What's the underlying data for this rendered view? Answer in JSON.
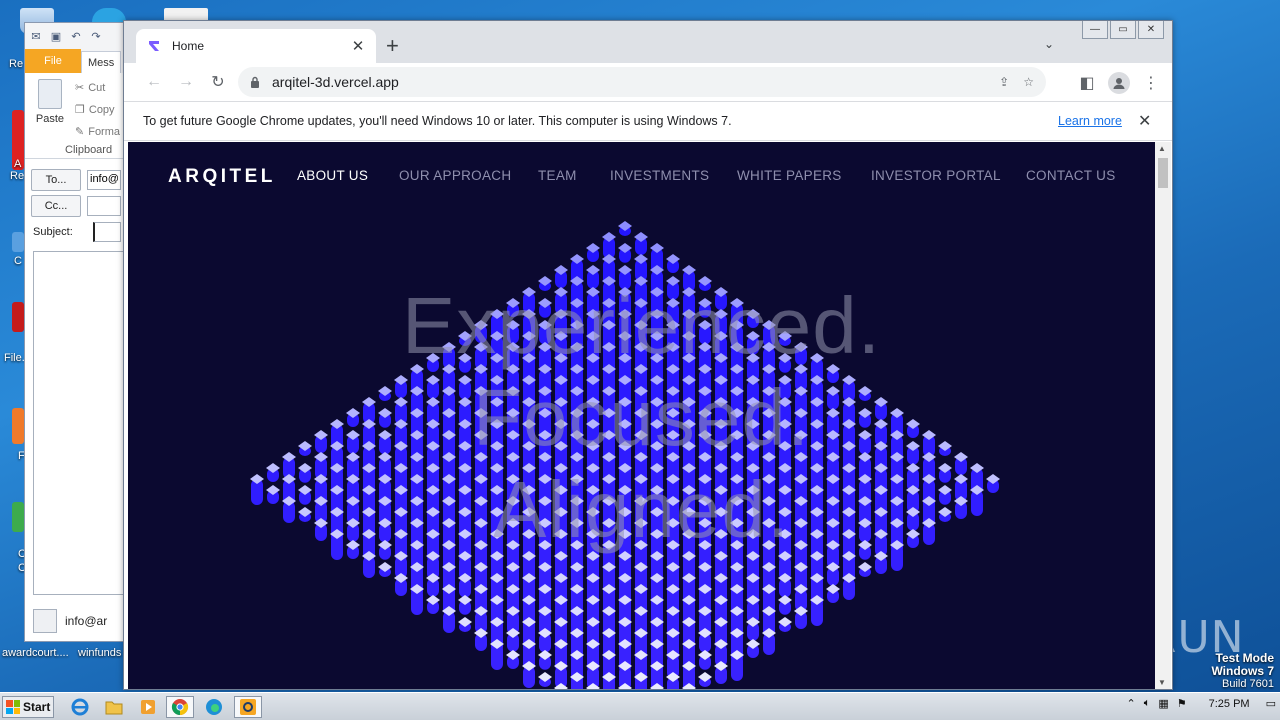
{
  "desktop": {
    "icons": [
      "recycle-bin",
      "edge",
      "file"
    ],
    "labels": {
      "recycle": "Re",
      "awardcourt": "awardcourt....",
      "winfunds": "winfunds",
      "filez": "File.",
      "a_re": "A",
      "re2": "Re",
      "c1": "C",
      "c2": "C",
      "f1": "F",
      "c3": "C",
      "c4": "C"
    },
    "watermark": "ANY RUN",
    "test_mode": {
      "line1": "Test Mode",
      "line2": "Windows 7",
      "line3": "Build 7601"
    }
  },
  "outlook": {
    "tabs": {
      "file": "File",
      "message": "Mess"
    },
    "ribbon": {
      "paste": "Paste",
      "cut": "Cut",
      "copy": "Copy",
      "format": "Forma",
      "clipboard": "Clipboard"
    },
    "to_button": "To...",
    "cc_button": "Cc...",
    "subject_label": "Subject:",
    "to_value": "info@",
    "cc_value": "",
    "subject_value": "",
    "footer_contact": "info@ar"
  },
  "chrome": {
    "tab_title": "Home",
    "url": "arqitel-3d.vercel.app",
    "infobar": {
      "message": "To get future Google Chrome updates, you'll need Windows 10 or later. This computer is using Windows 7.",
      "learn_more": "Learn more"
    }
  },
  "site": {
    "logo": "ARQITEL",
    "nav": [
      "ABOUT US",
      "OUR APPROACH",
      "TEAM",
      "INVESTMENTS",
      "WHITE PAPERS",
      "INVESTOR PORTAL",
      "CONTACT US"
    ],
    "active_nav": 0,
    "hero_lines": [
      "Experienced.",
      "Focused.",
      "Aligned."
    ]
  },
  "taskbar": {
    "start": "Start",
    "apps": [
      "ie",
      "explorer",
      "media",
      "chrome",
      "edge",
      "outlook"
    ],
    "clock": "7:25 PM"
  },
  "colors": {
    "site_bg": "#0b0930",
    "accent_blue": "#2a1cff",
    "outlook_file": "#f5a623"
  }
}
